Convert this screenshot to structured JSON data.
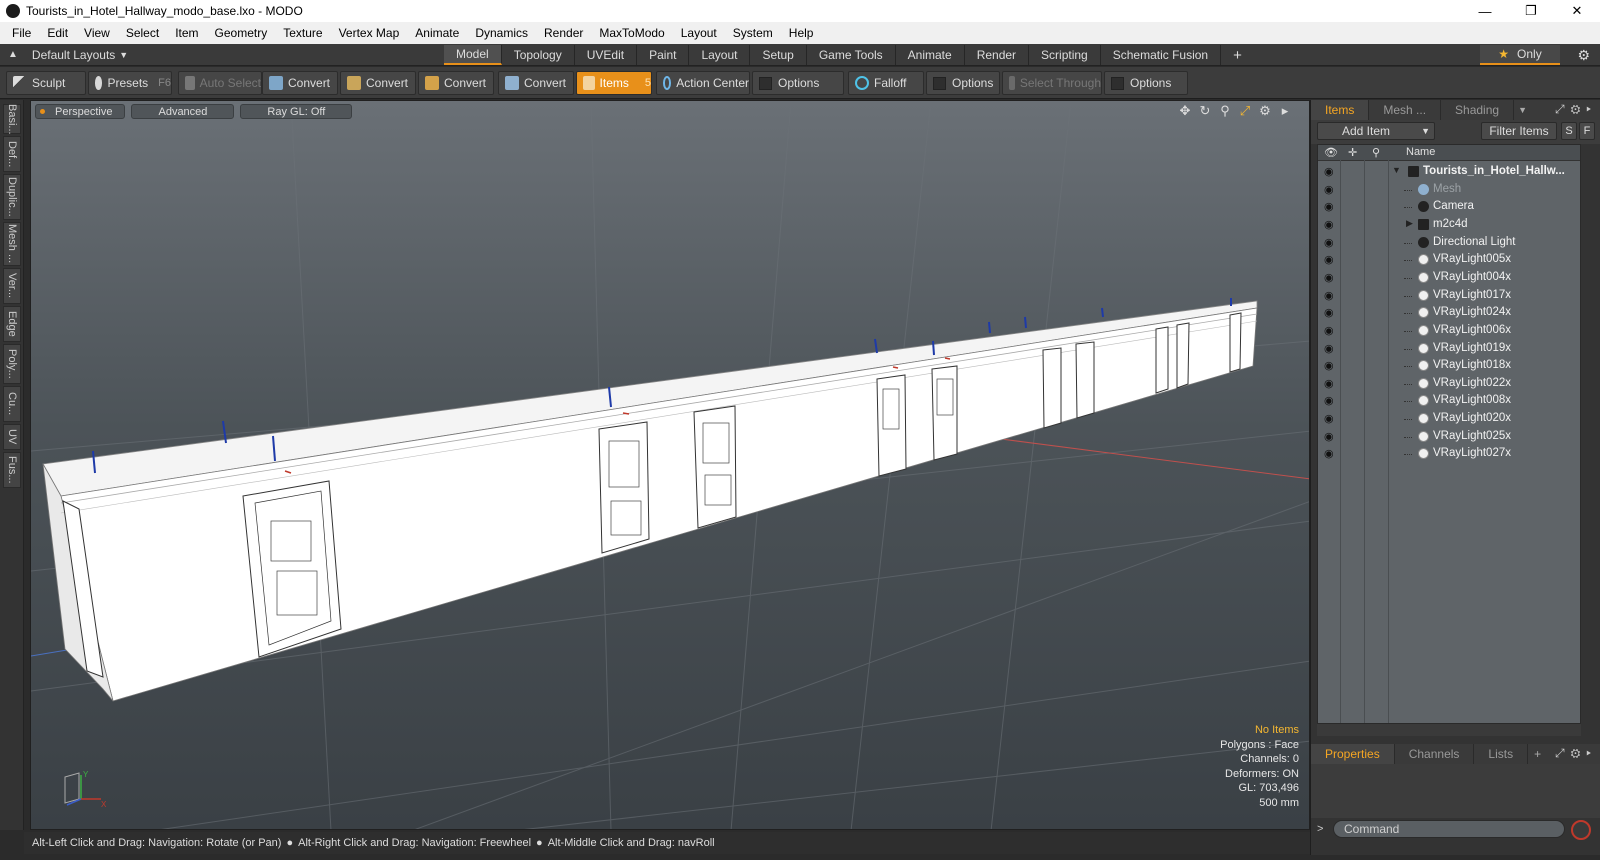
{
  "window": {
    "title": "Tourists_in_Hotel_Hallway_modo_base.lxo - MODO",
    "minimize": "—",
    "restore": "❐",
    "close": "✕"
  },
  "menubar": [
    "File",
    "Edit",
    "View",
    "Select",
    "Item",
    "Geometry",
    "Texture",
    "Vertex Map",
    "Animate",
    "Dynamics",
    "Render",
    "MaxToModo",
    "Layout",
    "System",
    "Help"
  ],
  "layouts": {
    "selector": "Default Layouts",
    "tabs": [
      "Model",
      "Topology",
      "UVEdit",
      "Paint",
      "Layout",
      "Setup",
      "Game Tools",
      "Animate",
      "Render",
      "Scripting",
      "Schematic Fusion"
    ],
    "active_tab": "Model",
    "add": "+",
    "only_label": "Only"
  },
  "toolbar": {
    "sculpt": "Sculpt",
    "presets": "Presets",
    "presets_key": "F6",
    "auto_select": "Auto Select",
    "convert1": "Convert",
    "convert2": "Convert",
    "convert3": "Convert",
    "convert4": "Convert",
    "items": "Items",
    "items_key": "5",
    "action_center": "Action Center",
    "options1": "Options",
    "falloff": "Falloff",
    "options2": "Options",
    "select_through": "Select Through",
    "options3": "Options"
  },
  "left_tabs": [
    "Basi...",
    "Def...",
    "Duplic...",
    "Mesh ...",
    "Ver...",
    "Edge",
    "Poly...",
    "Cu...",
    "UV",
    "Fus..."
  ],
  "viewport": {
    "view": "Perspective",
    "shading": "Advanced",
    "raygl": "Ray GL: Off",
    "info": {
      "no_items": "No Items",
      "polygons": "Polygons : Face",
      "channels": "Channels: 0",
      "deformers": "Deformers: ON",
      "gl": "GL: 703,496",
      "scale": "500 mm"
    },
    "axis_y": "Y",
    "axis_x": "X"
  },
  "statusbar": {
    "hint1": "Alt-Left Click and Drag: Navigation: Rotate (or Pan)",
    "hint2": "Alt-Right Click and Drag: Navigation: Freewheel",
    "hint3": "Alt-Middle Click and Drag: navRoll"
  },
  "panel": {
    "tabs": [
      "Items",
      "Mesh ...",
      "Shading"
    ],
    "add_item": "Add Item",
    "filter_items": "Filter Items",
    "s_btn": "S",
    "f_btn": "F",
    "name_col": "Name",
    "items": [
      {
        "label": "Tourists_in_Hotel_Hallw...",
        "kind": "scene"
      },
      {
        "label": "Mesh",
        "kind": "mesh"
      },
      {
        "label": "Camera",
        "kind": "camera"
      },
      {
        "label": "m2c4d",
        "kind": "group"
      },
      {
        "label": "Directional Light",
        "kind": "dirlight"
      },
      {
        "label": "VRayLight005x",
        "kind": "light"
      },
      {
        "label": "VRayLight004x",
        "kind": "light"
      },
      {
        "label": "VRayLight017x",
        "kind": "light"
      },
      {
        "label": "VRayLight024x",
        "kind": "light"
      },
      {
        "label": "VRayLight006x",
        "kind": "light"
      },
      {
        "label": "VRayLight019x",
        "kind": "light"
      },
      {
        "label": "VRayLight018x",
        "kind": "light"
      },
      {
        "label": "VRayLight022x",
        "kind": "light"
      },
      {
        "label": "VRayLight008x",
        "kind": "light"
      },
      {
        "label": "VRayLight020x",
        "kind": "light"
      },
      {
        "label": "VRayLight025x",
        "kind": "light"
      },
      {
        "label": "VRayLight027x",
        "kind": "light"
      }
    ],
    "bottom_tabs": [
      "Properties",
      "Channels",
      "Lists"
    ],
    "command_placeholder": "Command"
  },
  "colors": {
    "accent": "#e8901a",
    "panel_active_tab": "#f5a623",
    "info_highlight": "#f5b731"
  }
}
